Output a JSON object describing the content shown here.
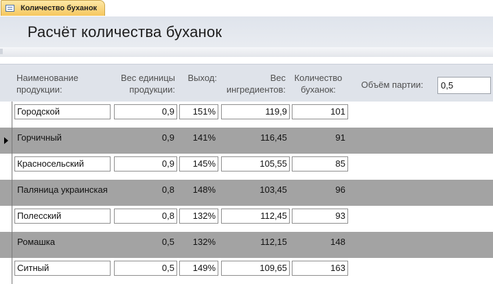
{
  "tab": {
    "label": "Количество буханок",
    "icon": "form-icon"
  },
  "form": {
    "title": "Расчёт количества буханок"
  },
  "columns": {
    "name": "Наименование продукции:",
    "weight": "Вес единицы продукции:",
    "yield": "Выход:",
    "ingredients": "Вес ингредиентов:",
    "count": "Количество буханок:"
  },
  "batch": {
    "label": "Объём партии:",
    "value": "0,5"
  },
  "current_row_index": 1,
  "rows": [
    {
      "name": "Городской",
      "weight": "0,9",
      "yield": "151%",
      "ingredients": "119,9",
      "count": "101"
    },
    {
      "name": "Горчичный",
      "weight": "0,9",
      "yield": "141%",
      "ingredients": "116,45",
      "count": "91"
    },
    {
      "name": "Красносельский",
      "weight": "0,9",
      "yield": "145%",
      "ingredients": "105,55",
      "count": "85"
    },
    {
      "name": "Паляница украинская",
      "weight": "0,8",
      "yield": "148%",
      "ingredients": "103,45",
      "count": "96"
    },
    {
      "name": "Полесский",
      "weight": "0,8",
      "yield": "132%",
      "ingredients": "112,45",
      "count": "93"
    },
    {
      "name": "Ромашка",
      "weight": "0,5",
      "yield": "132%",
      "ingredients": "112,15",
      "count": "148"
    },
    {
      "name": "Ситный",
      "weight": "0,5",
      "yield": "149%",
      "ingredients": "109,65",
      "count": "163"
    }
  ]
}
